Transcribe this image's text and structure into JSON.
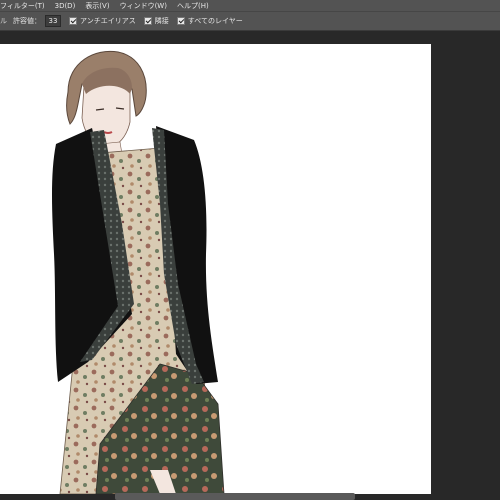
{
  "menubar": {
    "items": [
      "フィルター(T)",
      "3D(D)",
      "表示(V)",
      "ウィンドウ(W)",
      "ヘルプ(H)"
    ]
  },
  "options": {
    "tool_fragment": "ル",
    "tolerance_label": "許容値：",
    "tolerance_value": "33",
    "antialias_label": "アンチエイリアス",
    "contiguous_label": "隣接",
    "all_layers_label": "すべてのレイヤー"
  },
  "colors": {
    "panel_bg": "#535353",
    "workspace_bg": "#282828",
    "document_bg": "#ffffff",
    "jacket": "#111111",
    "dress_base": "#d8cbb3"
  }
}
